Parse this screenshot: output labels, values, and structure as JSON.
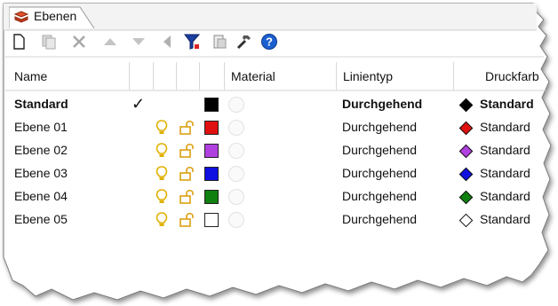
{
  "tab": {
    "label": "Ebenen"
  },
  "toolbar": {
    "buttons": [
      {
        "icon": "new-layer-icon"
      },
      {
        "icon": "new-sublayer-icon"
      },
      {
        "icon": "delete-icon"
      },
      {
        "icon": "move-up-icon"
      },
      {
        "icon": "move-down-icon"
      },
      {
        "icon": "move-to-parent-icon"
      },
      {
        "icon": "filter-icon"
      },
      {
        "icon": "layer-state-icon"
      },
      {
        "icon": "tools-icon"
      },
      {
        "icon": "help-icon"
      }
    ]
  },
  "columns": {
    "name": "Name",
    "material": "Material",
    "linetype": "Linientyp",
    "printcolor": "Druckfarbe"
  },
  "rows": [
    {
      "name": "Standard",
      "current": true,
      "checkmark": "✓",
      "color": "#000000",
      "linetype": "Durchgehend",
      "printcolor_label": "Standard",
      "printcolor": "#000000"
    },
    {
      "name": "Ebene 01",
      "current": false,
      "color": "#e01010",
      "linetype": "Durchgehend",
      "printcolor_label": "Standard",
      "printcolor": "#e01010"
    },
    {
      "name": "Ebene 02",
      "current": false,
      "color": "#b040e0",
      "linetype": "Durchgehend",
      "printcolor_label": "Standard",
      "printcolor": "#b040e0"
    },
    {
      "name": "Ebene 03",
      "current": false,
      "color": "#1010e0",
      "linetype": "Durchgehend",
      "printcolor_label": "Standard",
      "printcolor": "#1010e0"
    },
    {
      "name": "Ebene 04",
      "current": false,
      "color": "#108010",
      "linetype": "Durchgehend",
      "printcolor_label": "Standard",
      "printcolor": "#108010"
    },
    {
      "name": "Ebene 05",
      "current": false,
      "color": "#ffffff",
      "linetype": "Durchgehend",
      "printcolor_label": "Standard",
      "printcolor": "#ffffff"
    }
  ],
  "colors": {
    "accent": "#1a6fd6",
    "bulb": "#e0b000",
    "lock": "#d89a00"
  }
}
